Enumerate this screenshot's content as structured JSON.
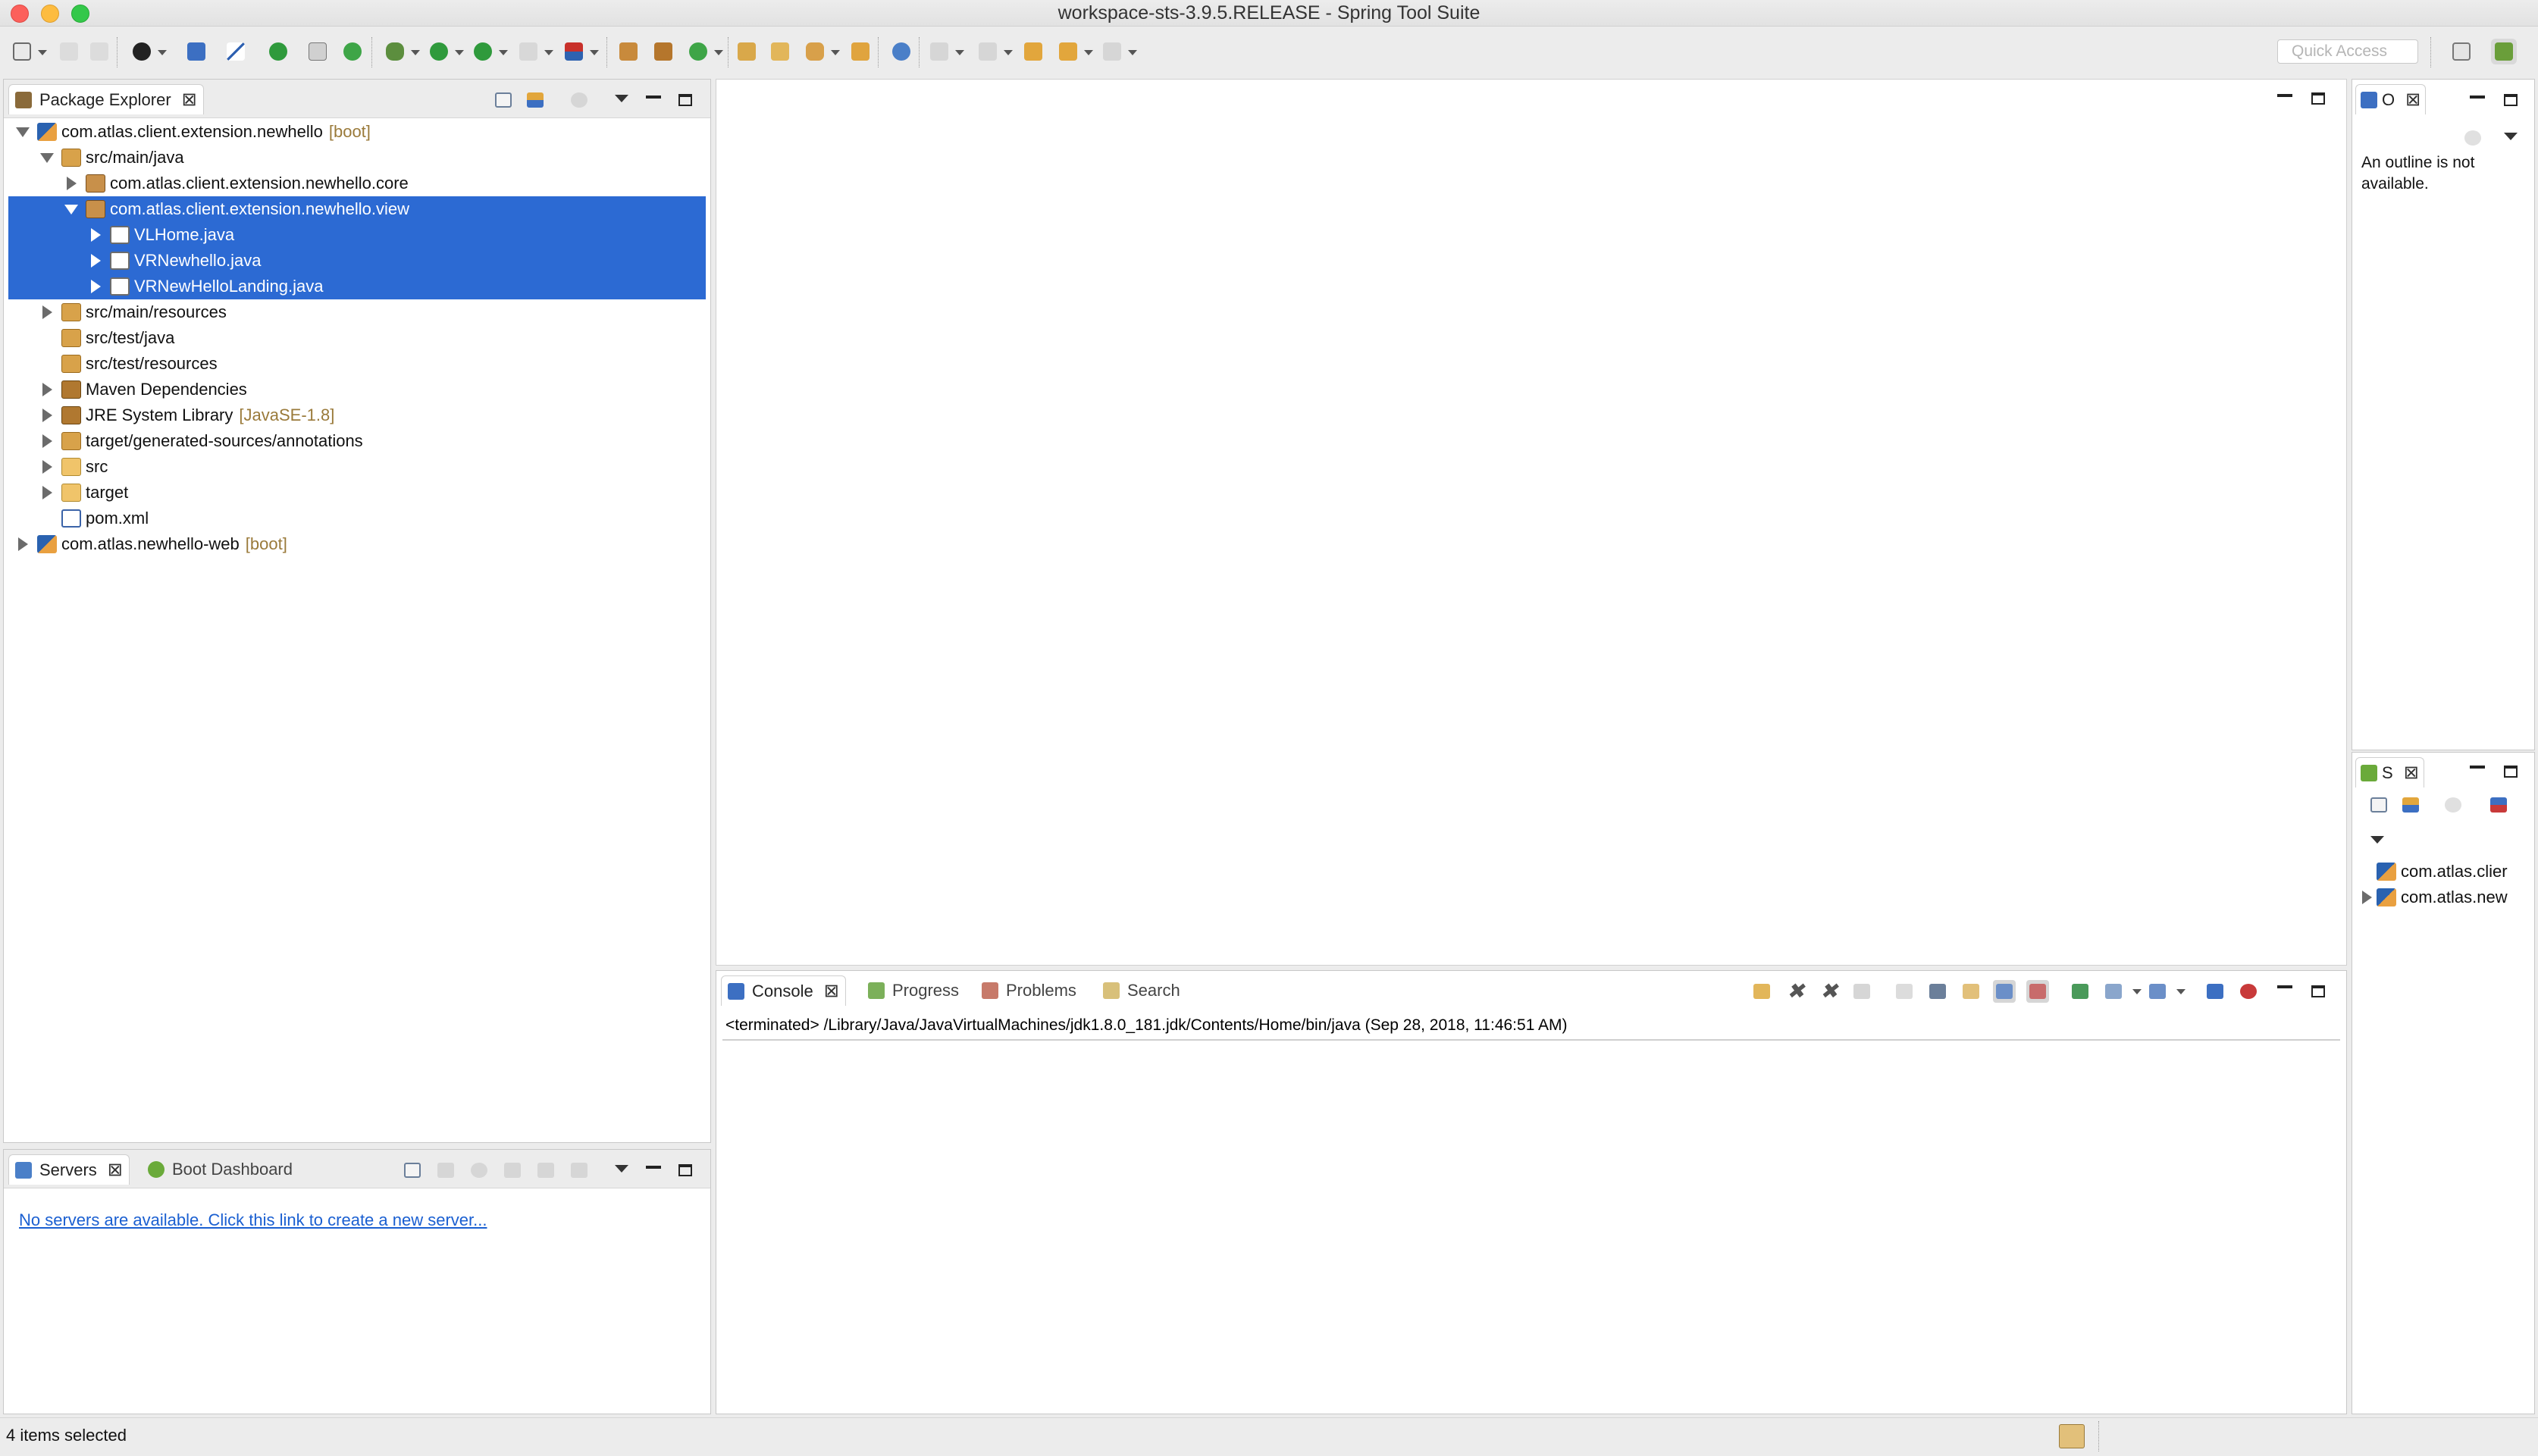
{
  "window": {
    "title": "workspace-sts-3.9.5.RELEASE - Spring Tool Suite"
  },
  "toolbar": {
    "quick_access_placeholder": "Quick Access",
    "icons": [
      "new-icon",
      "save-icon",
      "save-all-icon",
      "profile-icon",
      "terminal-icon",
      "skip-breakpoints-icon",
      "start-server-icon",
      "toggle-mark-icon",
      "refresh-icon",
      "debug-icon",
      "run-icon",
      "run-external-icon",
      "stop-icon",
      "coverage-icon",
      "new-java-project-icon",
      "new-package-icon",
      "new-class-icon",
      "open-type-icon",
      "open-task-icon",
      "search-icon",
      "annotation-icon",
      "globe-icon",
      "next-annotation-icon",
      "prev-annotation-icon",
      "back-icon",
      "forward-icon"
    ]
  },
  "package_explorer": {
    "tab_label": "Package Explorer",
    "tree": [
      {
        "label": "com.atlas.client.extension.newhello",
        "decoration": "[boot]",
        "depth": 0,
        "expanded": true,
        "selected": false,
        "icon": "maven-project-icon"
      },
      {
        "label": "src/main/java",
        "decoration": "",
        "depth": 1,
        "expanded": true,
        "selected": false,
        "icon": "source-folder-icon"
      },
      {
        "label": "com.atlas.client.extension.newhello.core",
        "decoration": "",
        "depth": 2,
        "expanded": false,
        "selected": false,
        "icon": "package-icon"
      },
      {
        "label": "com.atlas.client.extension.newhello.view",
        "decoration": "",
        "depth": 2,
        "expanded": true,
        "selected": true,
        "icon": "package-icon"
      },
      {
        "label": "VLHome.java",
        "decoration": "",
        "depth": 3,
        "expanded": false,
        "selected": true,
        "icon": "java-file-icon"
      },
      {
        "label": "VRNewhello.java",
        "decoration": "",
        "depth": 3,
        "expanded": false,
        "selected": true,
        "icon": "java-file-icon"
      },
      {
        "label": "VRNewHelloLanding.java",
        "decoration": "",
        "depth": 3,
        "expanded": false,
        "selected": true,
        "icon": "java-file-icon"
      },
      {
        "label": "src/main/resources",
        "decoration": "",
        "depth": 1,
        "expanded": false,
        "selected": false,
        "icon": "source-folder-icon"
      },
      {
        "label": "src/test/java",
        "decoration": "",
        "depth": 1,
        "expanded": null,
        "selected": false,
        "icon": "source-folder-icon"
      },
      {
        "label": "src/test/resources",
        "decoration": "",
        "depth": 1,
        "expanded": null,
        "selected": false,
        "icon": "source-folder-icon"
      },
      {
        "label": "Maven Dependencies",
        "decoration": "",
        "depth": 1,
        "expanded": false,
        "selected": false,
        "icon": "library-icon"
      },
      {
        "label": "JRE System Library",
        "decoration": "[JavaSE-1.8]",
        "depth": 1,
        "expanded": false,
        "selected": false,
        "icon": "library-icon"
      },
      {
        "label": "target/generated-sources/annotations",
        "decoration": "",
        "depth": 1,
        "expanded": false,
        "selected": false,
        "icon": "source-folder-icon"
      },
      {
        "label": "src",
        "decoration": "",
        "depth": 1,
        "expanded": false,
        "selected": false,
        "icon": "folder-icon"
      },
      {
        "label": "target",
        "decoration": "",
        "depth": 1,
        "expanded": false,
        "selected": false,
        "icon": "folder-icon"
      },
      {
        "label": "pom.xml",
        "decoration": "",
        "depth": 1,
        "expanded": null,
        "selected": false,
        "icon": "xml-file-icon"
      },
      {
        "label": "com.atlas.newhello-web",
        "decoration": "[boot]",
        "depth": 0,
        "expanded": false,
        "selected": false,
        "icon": "maven-project-icon"
      }
    ]
  },
  "servers": {
    "tab_label": "Servers",
    "tab2_label": "Boot Dashboard",
    "link_text": "No servers are available. Click this link to create a new server..."
  },
  "console": {
    "tabs": [
      "Console",
      "Progress",
      "Problems",
      "Search"
    ],
    "line": "<terminated> /Library/Java/JavaVirtualMachines/jdk1.8.0_181.jdk/Contents/Home/bin/java (Sep 28, 2018, 11:46:51 AM)"
  },
  "outline": {
    "tab_label": "O",
    "message": "An outline is not available."
  },
  "spring_explorer": {
    "tab_label": "S",
    "items": [
      {
        "label": "com.atlas.clier",
        "expanded": null
      },
      {
        "label": "com.atlas.new",
        "expanded": false
      }
    ]
  },
  "status": {
    "text": "4 items selected"
  },
  "colors": {
    "selection": "#2c6ad3",
    "link": "#1a5fd1",
    "decoration": "#9a7a3a"
  }
}
